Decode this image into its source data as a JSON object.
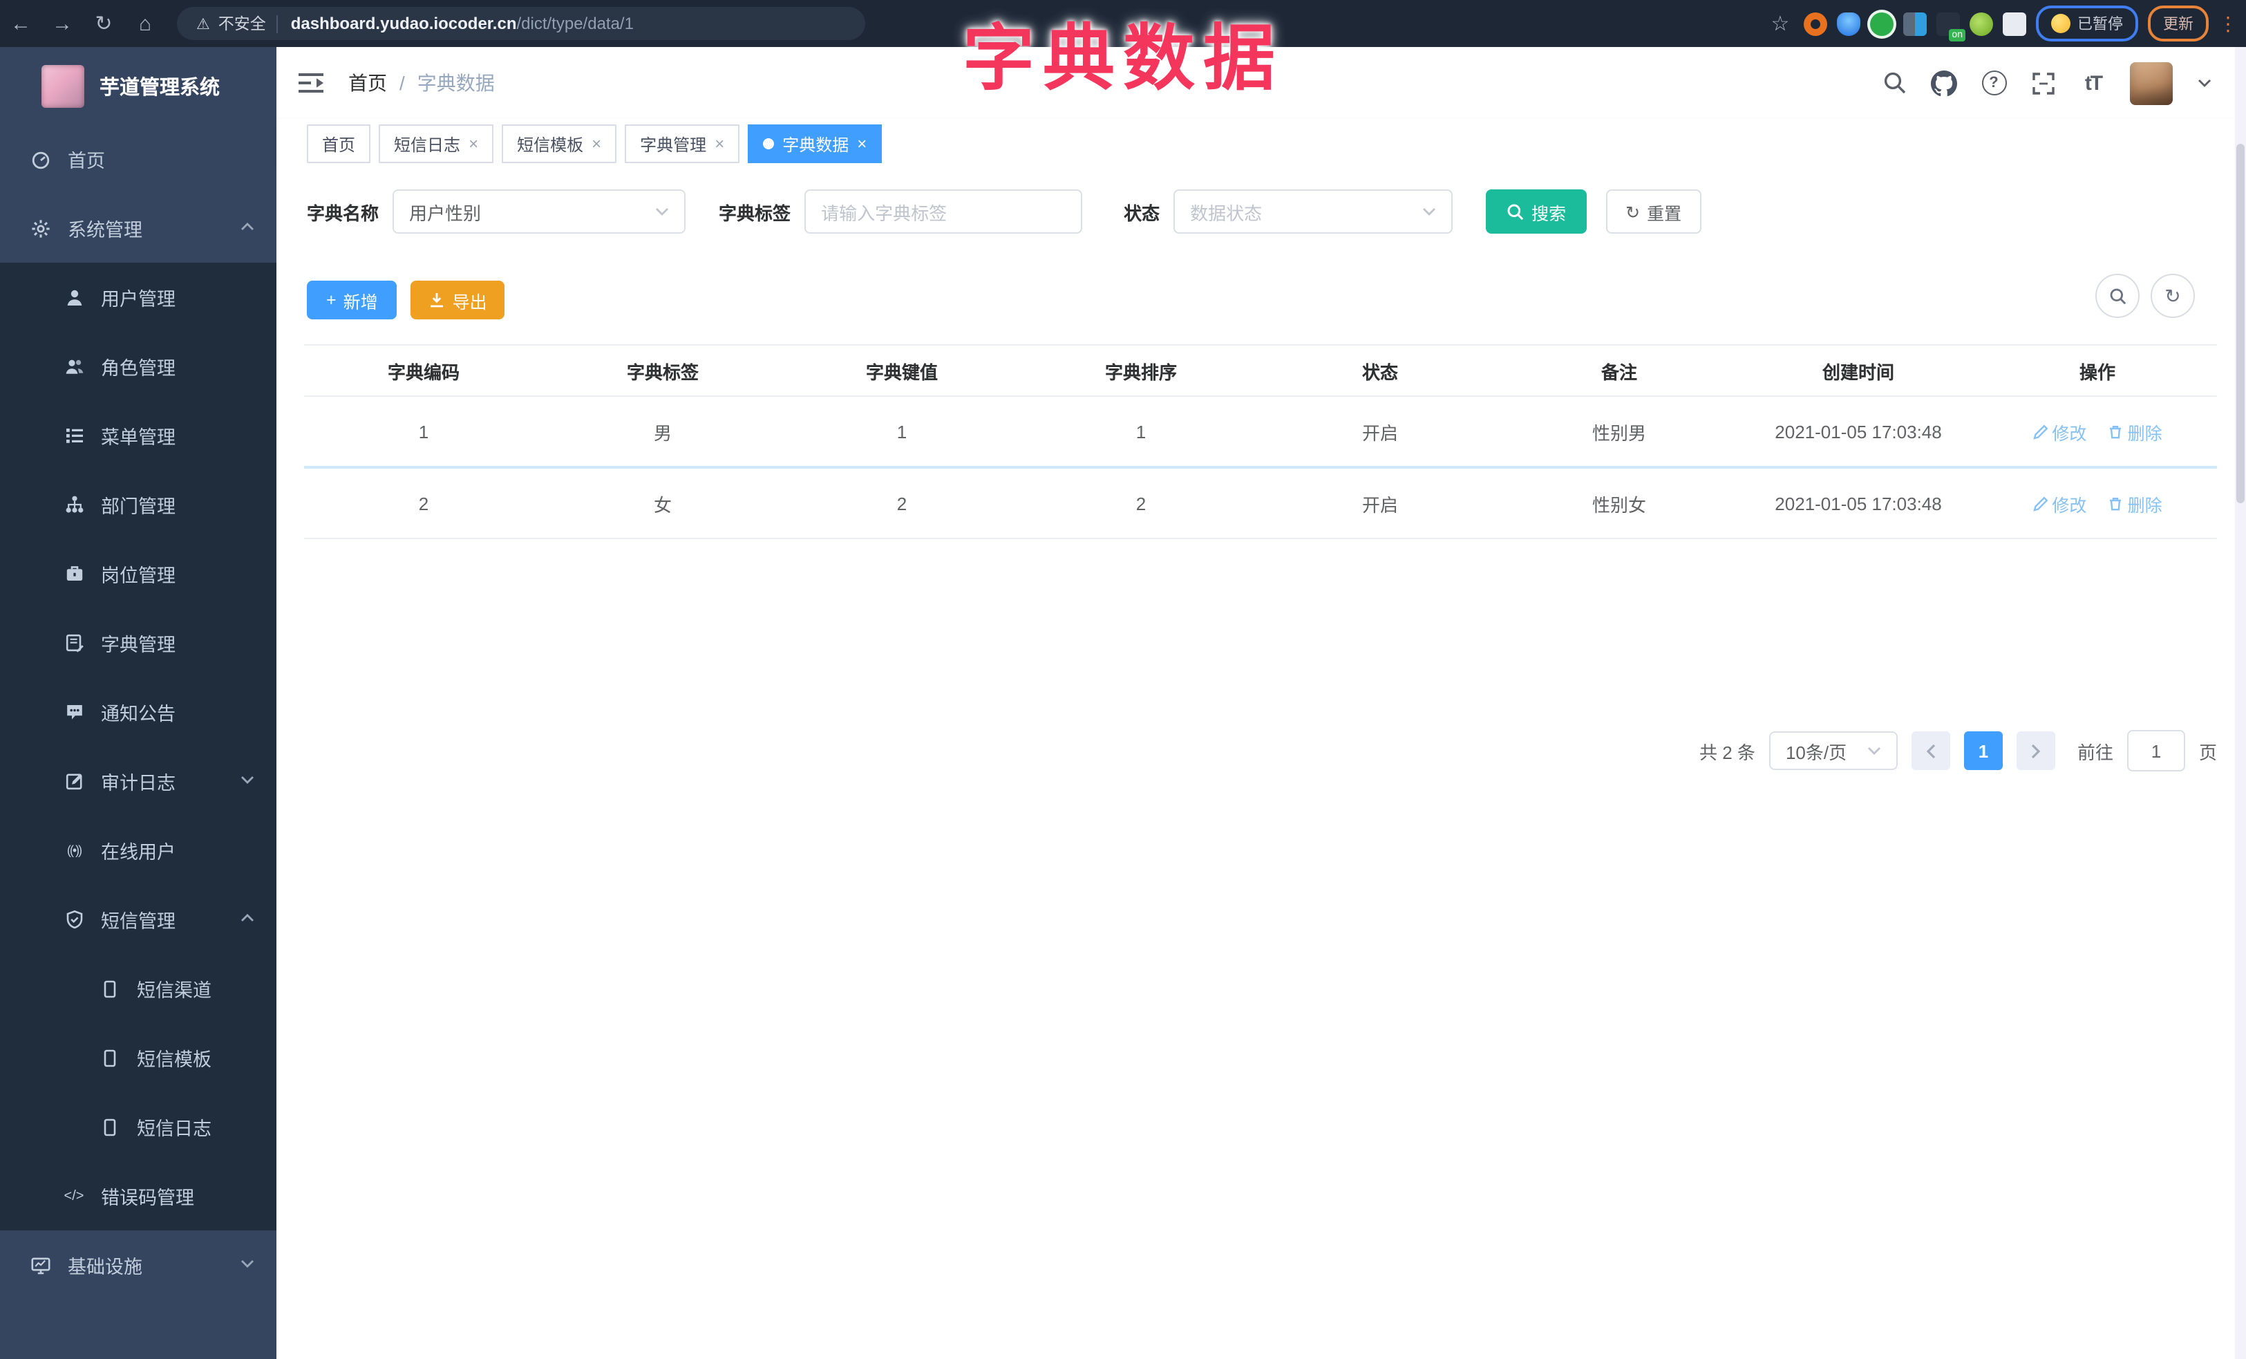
{
  "overlay": {
    "title": "字典数据"
  },
  "browser": {
    "not_secure": "不安全",
    "url_domain": "dashboard.yudao.iocoder.cn",
    "url_path": "/dict/type/data/1",
    "paused_label": "已暂停",
    "update_label": "更新",
    "ext_on_badge": "on"
  },
  "icons": {
    "back": "←",
    "forward": "→",
    "reload": "↻",
    "home": "⌂",
    "warning": "⚠",
    "star": "☆",
    "kebab": "⋮",
    "close": "×",
    "plus": "+",
    "refresh": "↻",
    "font_size": "tT",
    "help": "?",
    "code_glyph": "</>",
    "online_glyph": "((•))",
    "crumb_sep": "/"
  },
  "sidebar": {
    "title": "芋道管理系统",
    "items": [
      {
        "label": "首页"
      },
      {
        "label": "系统管理"
      },
      {
        "label": "用户管理"
      },
      {
        "label": "角色管理"
      },
      {
        "label": "菜单管理"
      },
      {
        "label": "部门管理"
      },
      {
        "label": "岗位管理"
      },
      {
        "label": "字典管理"
      },
      {
        "label": "通知公告"
      },
      {
        "label": "审计日志"
      },
      {
        "label": "在线用户"
      },
      {
        "label": "短信管理"
      },
      {
        "label": "短信渠道"
      },
      {
        "label": "短信模板"
      },
      {
        "label": "短信日志"
      },
      {
        "label": "错误码管理"
      },
      {
        "label": "基础设施"
      }
    ]
  },
  "header": {
    "breadcrumb": [
      "首页",
      "字典数据"
    ]
  },
  "tabs": [
    {
      "label": "首页"
    },
    {
      "label": "短信日志"
    },
    {
      "label": "短信模板"
    },
    {
      "label": "字典管理"
    },
    {
      "label": "字典数据"
    }
  ],
  "filters": {
    "name_label": "字典名称",
    "name_value": "用户性别",
    "tag_label": "字典标签",
    "tag_placeholder": "请输入字典标签",
    "status_label": "状态",
    "status_placeholder": "数据状态",
    "search_label": "搜索",
    "reset_label": "重置"
  },
  "toolbar": {
    "add_label": "新增",
    "export_label": "导出"
  },
  "table": {
    "headers": [
      "字典编码",
      "字典标签",
      "字典键值",
      "字典排序",
      "状态",
      "备注",
      "创建时间",
      "操作"
    ],
    "ops": {
      "edit": "修改",
      "delete": "删除"
    },
    "rows": [
      {
        "code": "1",
        "tag": "男",
        "value": "1",
        "sort": "1",
        "status": "开启",
        "remark": "性别男",
        "created": "2021-01-05 17:03:48"
      },
      {
        "code": "2",
        "tag": "女",
        "value": "2",
        "sort": "2",
        "status": "开启",
        "remark": "性别女",
        "created": "2021-01-05 17:03:48"
      }
    ]
  },
  "pagination": {
    "total": "共 2 条",
    "page_size": "10条/页",
    "current_page": "1",
    "goto_label": "前往",
    "goto_value": "1",
    "page_suffix": "页"
  },
  "colors": {
    "accent": "#409eff",
    "search_button": "#1abc9c",
    "export_button": "#f0a020",
    "annotation": "#f5365c"
  }
}
